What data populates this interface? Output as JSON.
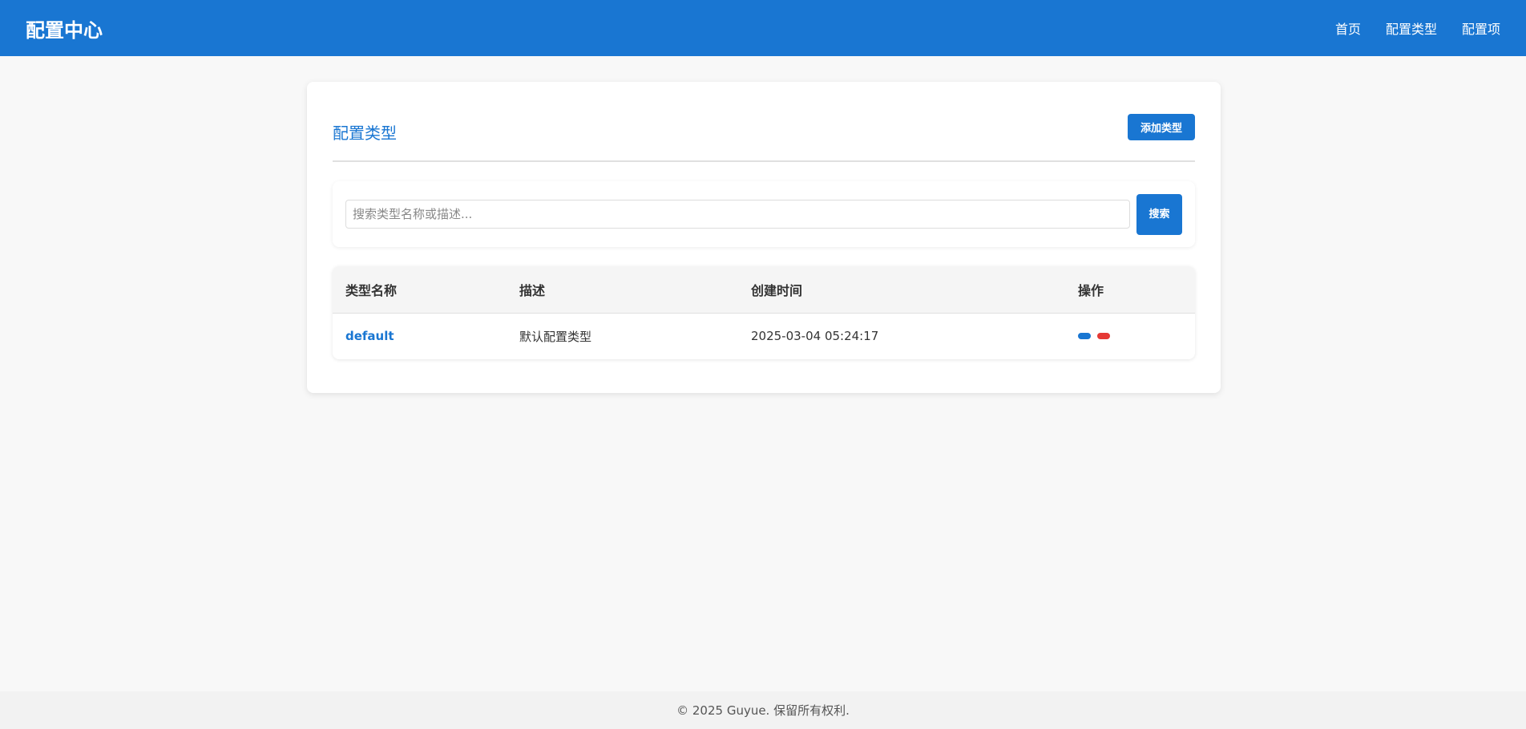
{
  "header": {
    "brand": "配置中心",
    "nav": [
      {
        "label": "首页"
      },
      {
        "label": "配置类型"
      },
      {
        "label": "配置项"
      }
    ]
  },
  "page": {
    "title": "配置类型",
    "add_button_label": "添加类型"
  },
  "search": {
    "placeholder": "搜索类型名称或描述...",
    "value": "",
    "button_label": "搜索"
  },
  "table": {
    "columns": [
      "类型名称",
      "描述",
      "创建时间",
      "操作"
    ],
    "rows": [
      {
        "name": "default",
        "description": "默认配置类型",
        "created_at": "2025-03-04 05:24:17",
        "actions": [
          {
            "name": "edit",
            "color": "#1976d2"
          },
          {
            "name": "delete",
            "color": "#e53935"
          }
        ]
      }
    ]
  },
  "footer": {
    "text": "© 2025 Guyue. 保留所有权利."
  },
  "colors": {
    "primary": "#1976d2",
    "danger": "#e53935",
    "background": "#f8f8f8"
  }
}
